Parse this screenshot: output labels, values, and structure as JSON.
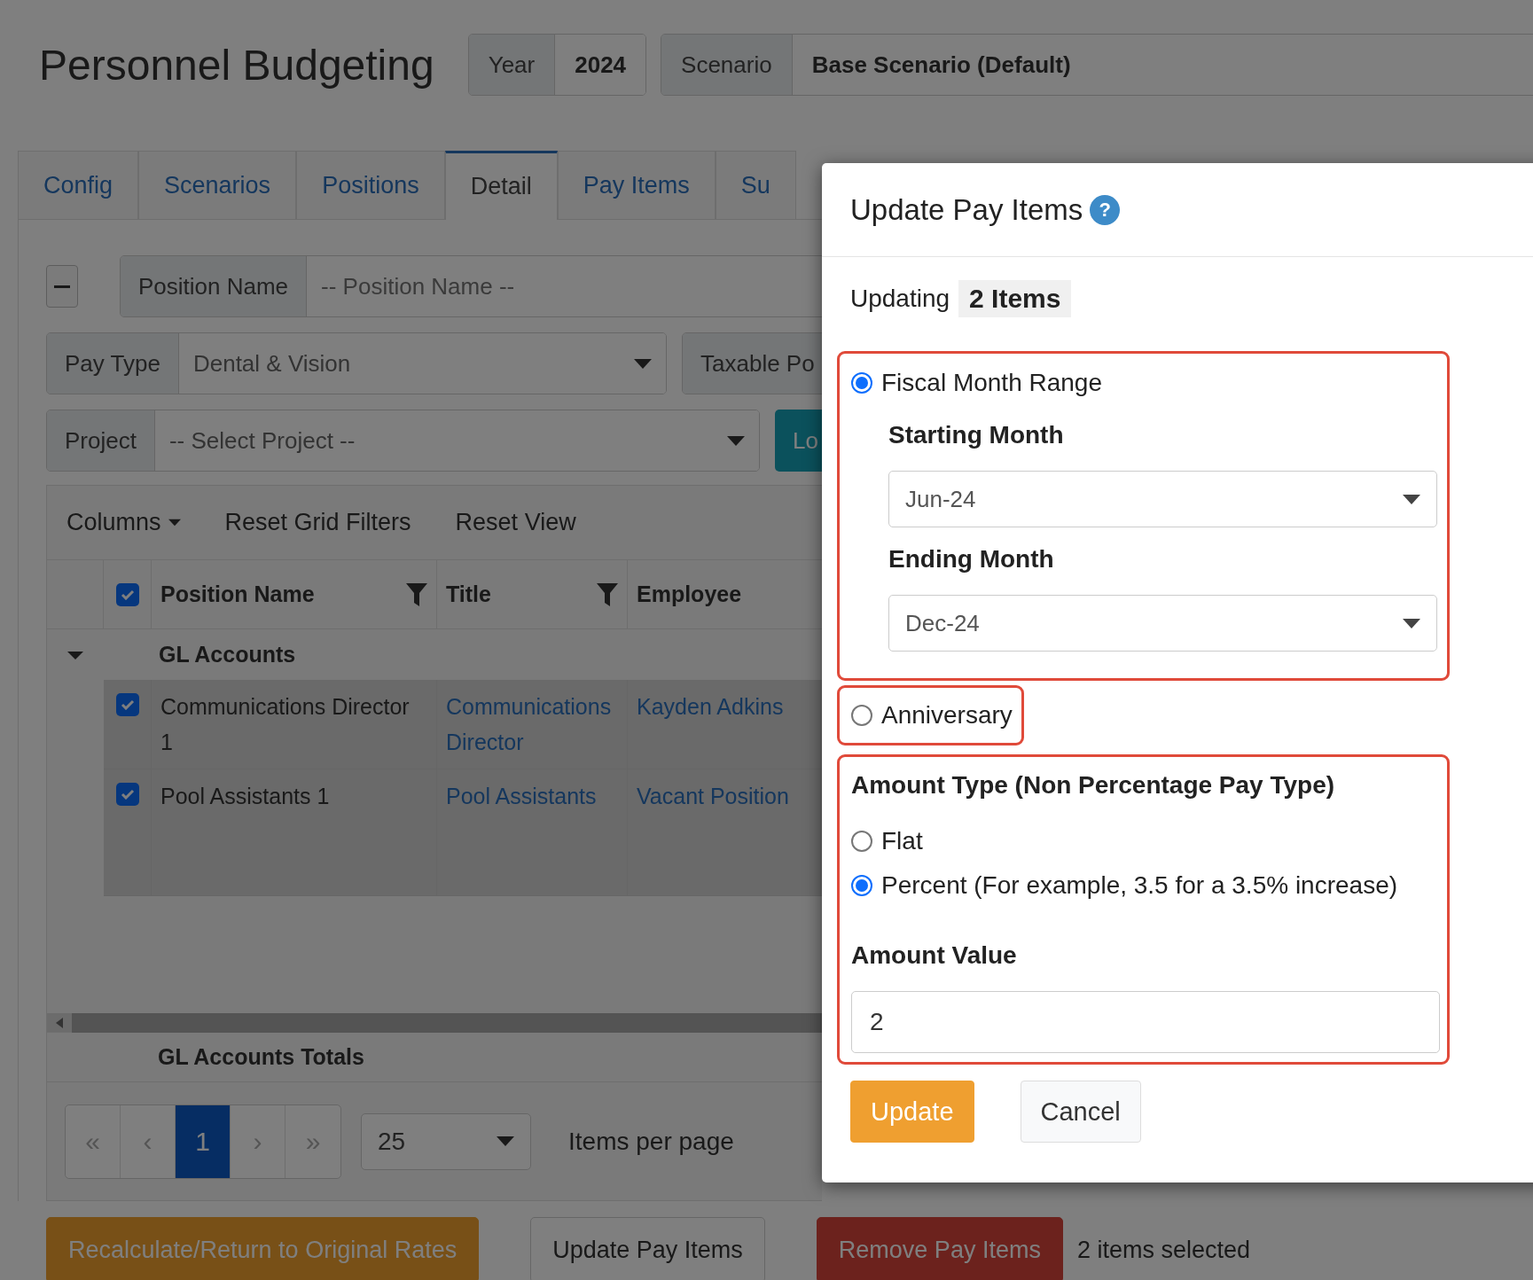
{
  "app_title": "Personnel Budgeting",
  "year": {
    "label": "Year",
    "value": "2024"
  },
  "scenario": {
    "label": "Scenario",
    "value": "Base Scenario (Default)"
  },
  "tabs": [
    {
      "label": "Config",
      "selected": false
    },
    {
      "label": "Scenarios",
      "selected": false
    },
    {
      "label": "Positions",
      "selected": false
    },
    {
      "label": "Detail",
      "selected": true
    },
    {
      "label": "Pay Items",
      "selected": false
    },
    {
      "label": "Su",
      "selected": false
    }
  ],
  "filters": {
    "position_name": {
      "label": "Position Name",
      "placeholder": "-- Position Name --"
    },
    "pay_type": {
      "label": "Pay Type",
      "value": "Dental & Vision"
    },
    "taxable": {
      "label": "Taxable Po"
    },
    "project": {
      "label": "Project",
      "value": "-- Select Project --"
    },
    "load_button": "Lo"
  },
  "grid_toolbar": [
    {
      "label": "Columns",
      "dropdown": true
    },
    {
      "label": "Reset Grid Filters",
      "dropdown": false
    },
    {
      "label": "Reset View",
      "dropdown": false
    }
  ],
  "table": {
    "all_checked": true,
    "columns": [
      {
        "label": "Position Name",
        "filter": true
      },
      {
        "label": "Title",
        "filter": true
      },
      {
        "label": "Employee",
        "filter": false
      }
    ],
    "group": {
      "label": "GL Accounts",
      "expanded": true
    },
    "rows": [
      {
        "checked": true,
        "position_name": "Communications Director 1",
        "title": "Communications Director",
        "employee": "Kayden Adkins"
      },
      {
        "checked": true,
        "position_name": "Pool Assistants 1",
        "title": "Pool Assistants",
        "employee": "Vacant Position"
      }
    ],
    "totals_label": "GL Accounts Totals"
  },
  "pager": {
    "first": "«",
    "prev": "‹",
    "pages": [
      {
        "label": "1",
        "selected": true
      }
    ],
    "next": "›",
    "last": "»",
    "page_size": "25",
    "page_size_label": "Items per page"
  },
  "actions": [
    {
      "label": "Recalculate/Return to Original Rates",
      "kind": "warning"
    },
    {
      "label": "Update Pay Items",
      "kind": "default"
    },
    {
      "label": "Remove Pay Items",
      "kind": "danger"
    }
  ],
  "selection_note": "2 items selected",
  "modal": {
    "title": "Update Pay Items",
    "help": "?",
    "updating_label": "Updating",
    "updating_count": "2 Items",
    "date_modes": [
      {
        "label": "Fiscal Month Range",
        "selected": true,
        "highlighted": true,
        "fields": [
          {
            "label": "Starting Month",
            "value": "Jun-24"
          },
          {
            "label": "Ending Month",
            "value": "Dec-24"
          }
        ]
      },
      {
        "label": "Anniversary",
        "selected": false,
        "highlighted": true
      }
    ],
    "amount": {
      "highlighted": true,
      "label": "Amount Type (Non Percentage Pay Type)",
      "options": [
        {
          "label": "Flat",
          "selected": false
        },
        {
          "label": "Percent (For example, 3.5 for a 3.5% increase)",
          "selected": true
        }
      ],
      "value_label": "Amount Value",
      "value": "2"
    },
    "buttons": [
      {
        "label": "Update",
        "kind": "primary"
      },
      {
        "label": "Cancel",
        "kind": "default"
      }
    ]
  }
}
